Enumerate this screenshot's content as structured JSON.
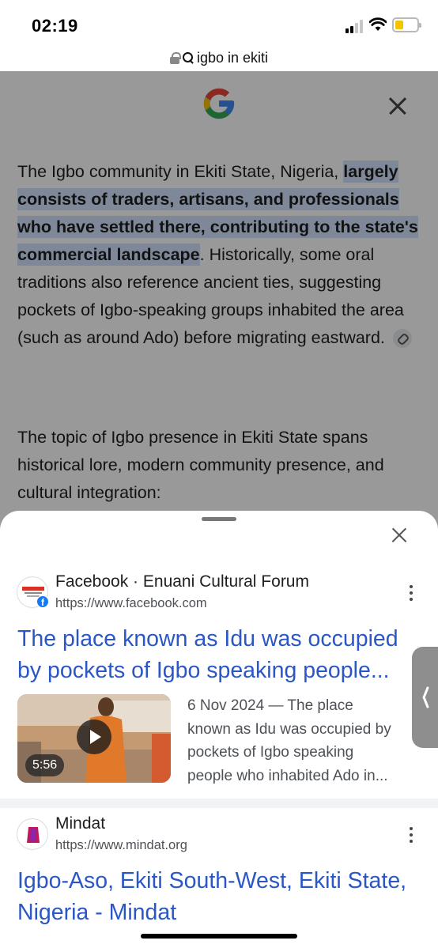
{
  "status_bar": {
    "time": "02:19"
  },
  "address_bar": {
    "query": "igbo in ekiti"
  },
  "ai_overview": {
    "p1_start": "The Igbo community in Ekiti State, Nigeria, ",
    "p1_highlight": "largely consists of traders, artisans, and professionals who have settled there, contributing to the state's commercial landscape",
    "p1_end": ". Historically, some oral traditions also reference ancient ties, suggesting pockets of Igbo-speaking groups inhabited the area (such as around Ado) before migrating eastward.",
    "p2": "The topic of Igbo presence in Ekiti State spans historical lore, modern community presence, and cultural integration:"
  },
  "results": [
    {
      "site": "Facebook · Enuani Cultural Forum",
      "url": "https://www.facebook.com",
      "title": "The place known as Idu was occupied by pockets of Igbo speaking people...",
      "duration": "5:56",
      "snippet_lines": [
        "6 Nov 2024 — The place",
        "known as Idu was occupied by",
        "pockets of Igbo speaking",
        "people who inhabited Ado in..."
      ]
    },
    {
      "site": "Mindat",
      "url": "https://www.mindat.org",
      "title": "Igbo-Aso, Ekiti South-West, Ekiti State, Nigeria - Mindat"
    }
  ],
  "colors": {
    "link_blue": "#2a56c6",
    "highlight": "#d3e3fd",
    "facebook_blue": "#1877f2",
    "battery_yellow": "#f2c500"
  },
  "icons": [
    "lock-icon",
    "search-icon",
    "google-logo-icon",
    "close-icon",
    "link-icon",
    "more-vert-icon",
    "play-icon",
    "chevron-left-icon",
    "facebook-icon"
  ]
}
